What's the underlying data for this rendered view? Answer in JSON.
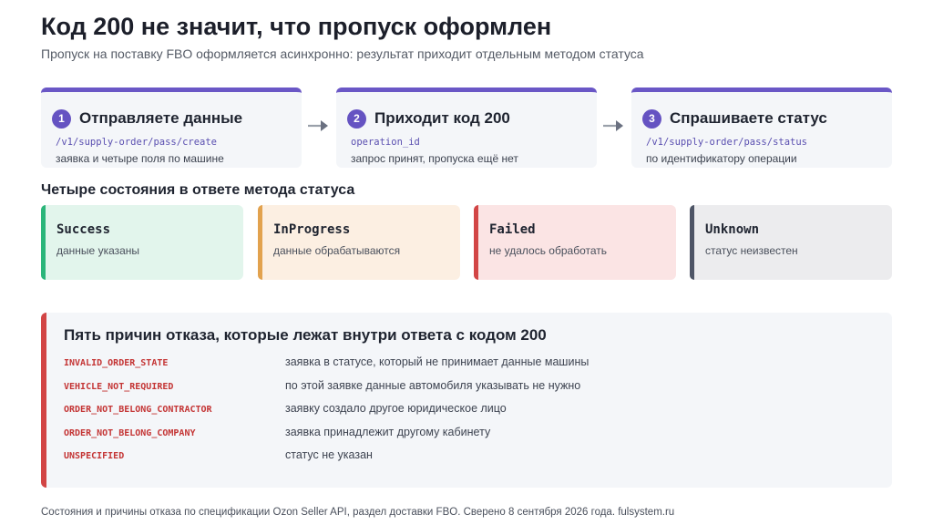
{
  "title": "Код 200 не значит, что пропуск оформлен",
  "subtitle": "Пропуск на поставку FBO оформляется асинхронно: результат приходит отдельным методом статуса",
  "steps": [
    {
      "num": "1",
      "title": "Отправляете данные",
      "code": "/v1/supply-order/pass/create",
      "desc": "заявка и четыре поля по машине"
    },
    {
      "num": "2",
      "title": "Приходит код 200",
      "code": "operation_id",
      "desc": "запрос принят, пропуска ещё нет"
    },
    {
      "num": "3",
      "title": "Спрашиваете статус",
      "code": "/v1/supply-order/pass/status",
      "desc": "по идентификатору операции"
    }
  ],
  "states_title": "Четыре состояния в ответе метода статуса",
  "states": [
    {
      "name": "Success",
      "desc": "данные указаны",
      "bg": "#e2f5ec",
      "accent": "#2bb57a"
    },
    {
      "name": "InProgress",
      "desc": "данные обрабатываются",
      "bg": "#fcefe2",
      "accent": "#e2a24e"
    },
    {
      "name": "Failed",
      "desc": "не удалось обработать",
      "bg": "#fbe4e4",
      "accent": "#d24545"
    },
    {
      "name": "Unknown",
      "desc": "статус неизвестен",
      "bg": "#ececee",
      "accent": "#4e5566"
    }
  ],
  "reasons": {
    "title": "Пять причин отказа, которые лежат внутри ответа с кодом 200",
    "items": [
      {
        "code": "INVALID_ORDER_STATE",
        "desc": "заявка в статусе, который не принимает данные машины"
      },
      {
        "code": "VEHICLE_NOT_REQUIRED",
        "desc": "по этой заявке данные автомобиля указывать не нужно"
      },
      {
        "code": "ORDER_NOT_BELONG_CONTRACTOR",
        "desc": "заявку создало другое юридическое лицо"
      },
      {
        "code": "ORDER_NOT_BELONG_COMPANY",
        "desc": "заявка принадлежит другому кабинету"
      },
      {
        "code": "UNSPECIFIED",
        "desc": "статус не указан"
      }
    ]
  },
  "footer": "Состояния и причины отказа по спецификации Ozon Seller API, раздел доставки FBO. Сверено 8 сентября 2026 года. fulsystem.ru",
  "colors": {
    "step_accent": "#6a57c6",
    "reason_accent": "#d24545",
    "panel_bg": "#f4f6f9"
  }
}
